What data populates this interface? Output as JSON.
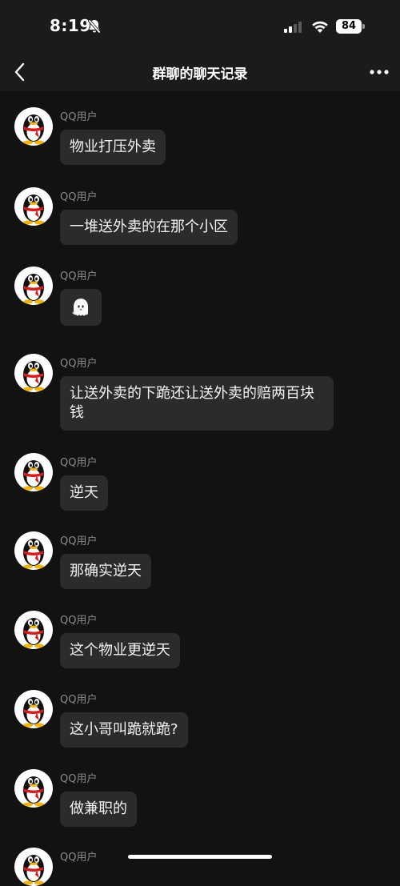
{
  "status_bar": {
    "time": "8:19",
    "battery": "84"
  },
  "nav": {
    "title": "群聊的聊天记录"
  },
  "messages": [
    {
      "sender": "QQ用户",
      "text": "物业打压外卖"
    },
    {
      "sender": "QQ用户",
      "text": "一堆送外卖的在那个小区"
    },
    {
      "sender": "QQ用户",
      "text": "",
      "sticker": "ghost-emoji"
    },
    {
      "sender": "QQ用户",
      "text": "让送外卖的下跪还让送外卖的赔两百块钱"
    },
    {
      "sender": "QQ用户",
      "text": "逆天"
    },
    {
      "sender": "QQ用户",
      "text": "那确实逆天"
    },
    {
      "sender": "QQ用户",
      "text": "这个物业更逆天"
    },
    {
      "sender": "QQ用户",
      "text": "这小哥叫跪就跪?"
    },
    {
      "sender": "QQ用户",
      "text": "做兼职的"
    },
    {
      "sender": "QQ用户",
      "text": ""
    }
  ]
}
